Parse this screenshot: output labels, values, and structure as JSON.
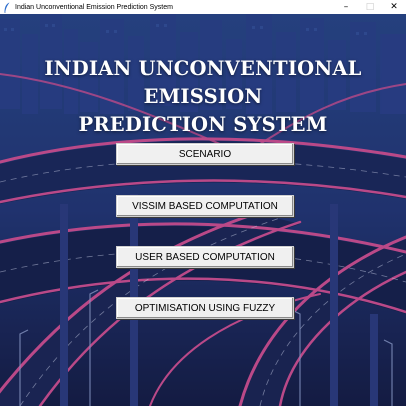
{
  "window": {
    "title": "Indian Unconventional Emission Prediction System",
    "minimize": "–",
    "maximize": "□",
    "close": "✕"
  },
  "heading": {
    "line1": "INDIAN UNCONVENTIONAL EMISSION",
    "line2": "PREDICTION SYSTEM"
  },
  "menu": {
    "scenario": "SCENARIO",
    "vissim": "VISSIM BASED COMPUTATION",
    "user": "USER BASED COMPUTATION",
    "fuzzy": "OPTIMISATION USING FUZZY"
  },
  "colors": {
    "sky": "#223a78",
    "road_pink": "#e0559a",
    "road_dark": "#1b2452",
    "building": "#2a3d80"
  }
}
